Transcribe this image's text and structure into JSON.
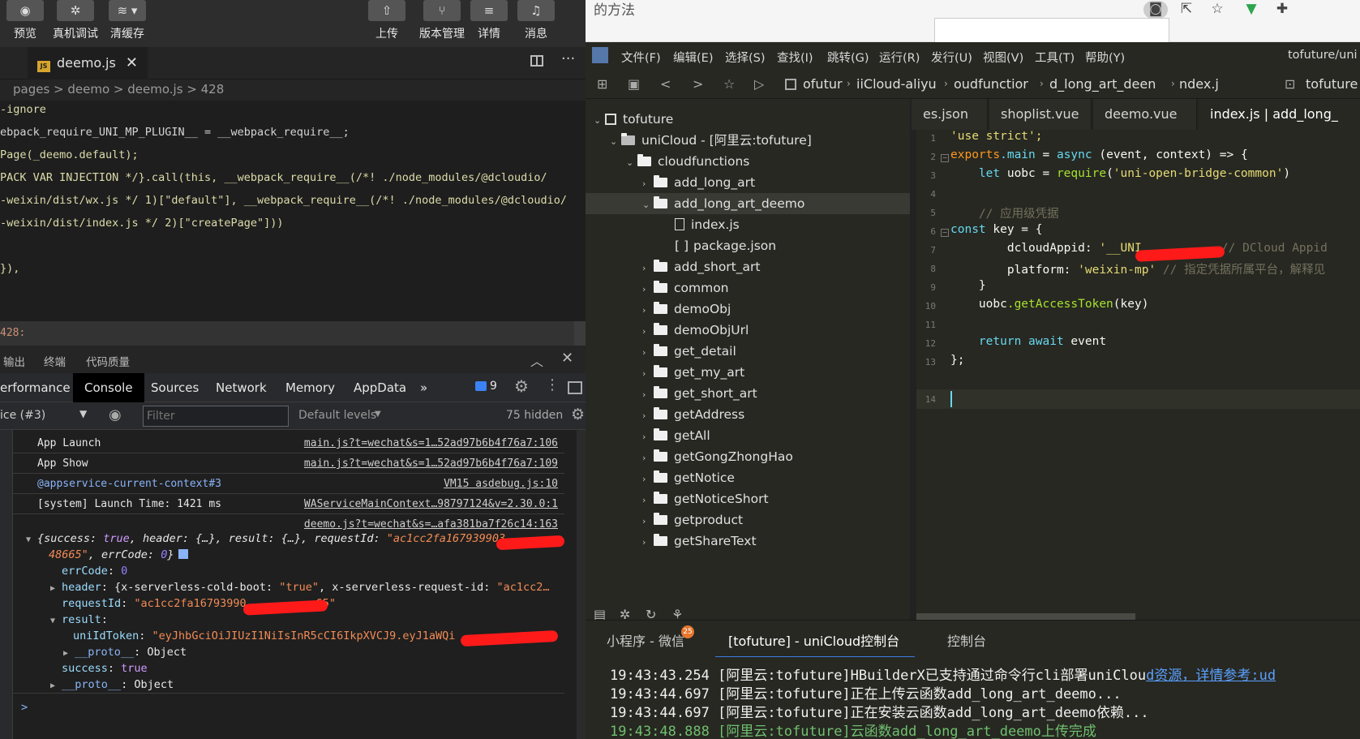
{
  "wx": {
    "toolbar": {
      "preview": "预览",
      "remote_debug": "真机调试",
      "clear_cache": "清缓存",
      "upload": "上传",
      "version": "版本管理",
      "details": "详情",
      "messages": "消息"
    },
    "file_tab": {
      "name": "deemo.js",
      "close": "✕"
    },
    "breadcrumb": "pages > deemo > deemo.js > 428",
    "code_lines": [
      "-ignore",
      "ebpack_require_UNI_MP_PLUGIN__ = __webpack_require__;",
      "Page(_deemo.default);",
      "PACK VAR INJECTION */}.call(this, __webpack_require__(/*! ./node_modules/@dcloudio/",
      "-weixin/dist/wx.js */ 1)[\"default\"], __webpack_require__(/*! ./node_modules/@dcloudio/",
      "-weixin/dist/index.js */ 2)[\"createPage\"]))",
      "",
      "}),"
    ],
    "status_line": "428:",
    "panel_tabs": [
      "输出",
      "终端",
      "代码质量"
    ],
    "devtools_tabs": [
      "erformance",
      "Console",
      "Sources",
      "Network",
      "Memory",
      "AppData",
      "»"
    ],
    "issue_count": "9",
    "context": "ice (#3)",
    "filter_placeholder": "Filter",
    "levels": "Default levels",
    "hidden": "75 hidden",
    "console_rows": [
      {
        "text": "App Launch",
        "src": "main.js?t=wechat&s=1…52ad97b6b4f76a7:106"
      },
      {
        "text": "App Show",
        "src": "main.js?t=wechat&s=1…52ad97b6b4f76a7:109"
      },
      {
        "text": "@appservice-current-context#3",
        "src": "VM15 asdebug.js:10"
      },
      {
        "text": "[system] Launch Time: 1421 ms",
        "src": "WAServiceMainContext…98797124&v=2.30.0:1"
      }
    ],
    "deemo_src": "deemo.js?t=wechat&s=…afa381ba7f26c14:163",
    "obj": {
      "summary_start": "{success: ",
      "summary_true": "true",
      "summary_mid": ", header: {…}, result: {…}, requestId: ",
      "summary_id": "\"ac1cc2fa167939903",
      "summary_line2_id": "48665\"",
      "summary_line2_rest": ", errCode: ",
      "summary_zero": "0",
      "summary_end": "}",
      "errcode_key": "errCode",
      "errcode_val": "0",
      "header_key": "header",
      "header_val": "{x-serverless-cold-boot: ",
      "header_true": "\"true\"",
      "header_val2": ", x-serverless-request-id: ",
      "header_id": "\"ac1cc2…",
      "reqid_key": "requestId",
      "reqid_val": "\"ac1cc2fa16793990",
      "reqid_tail": "65\"",
      "result_key": "result",
      "token_key": "uniIdToken",
      "token_val": "\"eyJhbGciOiJIUzI1NiIsInR5cCI6IkpXVCJ9.eyJ1aWQi",
      "token_tail": "…",
      "proto1": "Object",
      "success_key": "success",
      "success_val": "true",
      "proto2": "Object",
      "proto_key": "__proto__"
    },
    "prompt": ">"
  },
  "browser": {
    "title_fragment": "的方法"
  },
  "hbx": {
    "menu": [
      "文件(F)",
      "编辑(E)",
      "选择(S)",
      "查找(I)",
      "跳转(G)",
      "运行(R)",
      "发行(U)",
      "视图(V)",
      "工具(T)",
      "帮助(Y)"
    ],
    "project_title": "tofuture/uni",
    "path": [
      "ofutur",
      "iiCloud-aliyu",
      "oudfunctior",
      "d_long_art_deen",
      "ndex.j"
    ],
    "path_project": "tofuture",
    "tree": {
      "project": "tofuture",
      "unicloud": "uniCloud - [阿里云:tofuture]",
      "cloudfunctions": "cloudfunctions",
      "items_before": [
        "add_long_art"
      ],
      "selected": "add_long_art_deemo",
      "children": [
        "index.js",
        "package.json"
      ],
      "items_after": [
        "add_short_art",
        "common",
        "demoObj",
        "demoObjUrl",
        "get_detail",
        "get_my_art",
        "get_short_art",
        "getAddress",
        "getAll",
        "getGongZhongHao",
        "getNotice",
        "getNoticeShort",
        "getproduct",
        "getShareText"
      ]
    },
    "editor_tabs": [
      "es.json",
      "shoplist.vue",
      "deemo.vue",
      "index.js | add_long_"
    ],
    "code": {
      "l1": "'use strict';",
      "l2_a": "exports",
      "l2_b": ".main",
      "l2_c": " = ",
      "l2_d": "async",
      "l2_e": " (event, context) => {",
      "l3_a": "    let",
      "l3_b": " uobc = ",
      "l3_c": "require",
      "l3_d": "(",
      "l3_e": "'uni-open-bridge-common'",
      "l3_f": ")",
      "l5": "    // 应用级凭据",
      "l6_a": "const",
      "l6_b": " key = {",
      "l7_a": "        dcloudAppid: ",
      "l7_b": "'__UNI",
      "l7_c": "   // DCloud Appid",
      "l8_a": "        platform: ",
      "l8_b": "'weixin-mp'",
      "l8_c": " // 指定凭据所属平台，解释见",
      "l9": "    }",
      "l10_a": "    uobc",
      "l10_b": ".getAccessToken",
      "l10_c": "(key)",
      "l12_a": "    return",
      "l12_b": " await",
      "l12_c": " event",
      "l13": "};"
    },
    "line_numbers": [
      "1",
      "2",
      "3",
      "4",
      "5",
      "6",
      "7",
      "8",
      "9",
      "10",
      "11",
      "12",
      "13",
      "14"
    ],
    "console_tabs": [
      "小程序 - 微信",
      "[tofuture] - uniCloud控制台",
      "控制台"
    ],
    "badge": "25",
    "logs": [
      {
        "time": "19:43:43.254",
        "msg": "[阿里云:tofuture]HBuilderX已支持通过命令行cli部署uniClou",
        "link": "d资源，详情参考:ud"
      },
      {
        "time": "19:43:44.697",
        "msg": "[阿里云:tofuture]正在上传云函数add_long_art_deemo..."
      },
      {
        "time": "19:43:44.697",
        "msg": "[阿里云:tofuture]正在安装云函数add_long_art_deemo依赖..."
      },
      {
        "time": "19:43:48.888",
        "msg": "[阿里云:tofuture]云函数add_long_art_deemo上传完成"
      }
    ]
  }
}
